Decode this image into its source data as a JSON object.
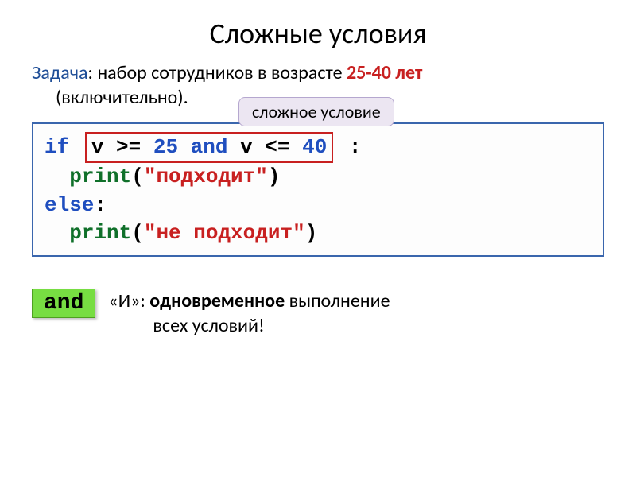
{
  "title": "Сложные условия",
  "task": {
    "label": "Задача",
    "text_before": ": набор сотрудников в возрасте ",
    "bold": "25-40 лет",
    "text_after": "(включительно)."
  },
  "callout": "сложное условие",
  "code": {
    "if_kw": "if",
    "cond_part1": "v >= ",
    "num1": "25",
    "and_kw": " and ",
    "cond_part2": "v <= ",
    "num2": "40",
    "colon": ":",
    "print_kw": "print",
    "str1": "\"подходит\"",
    "else_kw": "else",
    "str2": "\"не подходит\""
  },
  "and_badge": "and",
  "and_desc": {
    "prefix": "«И»: ",
    "bold": "одновременное",
    "suffix": " выполнение",
    "line2": "всех условий!"
  }
}
